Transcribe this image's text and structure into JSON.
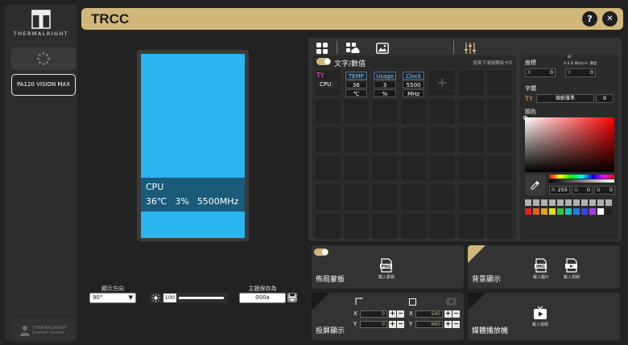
{
  "app": {
    "title": "TRCC",
    "help_label": "?",
    "close_label": "✕"
  },
  "sidebar": {
    "logo_text": "THERMALRIGHT",
    "device_label": "PA120 VISION MAX",
    "badge_line1": "THERMALRIGHT",
    "badge_line2": "Control Center"
  },
  "preview": {
    "line1": "CPU",
    "temp": "36℃",
    "usage": "3%",
    "clock": "5500MHz",
    "bg_color": "#2ab4f0",
    "band_color": "#1a5a7a"
  },
  "controls": {
    "direction_label": "顯示方向",
    "direction_value": "90°",
    "brightness_value": "100",
    "save_label": "主題保存為",
    "save_value": "000a"
  },
  "grid": {
    "title": "文字/數值",
    "hint": "按兩下清鼠刪除卡片",
    "cpu_label": "CPU",
    "columns": [
      {
        "header": "TEMP",
        "value": "36",
        "unit": "℃"
      },
      {
        "header": "Usage",
        "value": "3",
        "unit": "%"
      },
      {
        "header": "Clock",
        "value": "5500",
        "unit": "MHz"
      }
    ],
    "add_label": "+"
  },
  "props": {
    "coords_label": "座標",
    "w_label": "W",
    "hint_line": "A S D W/ctrl+ 滑鼠",
    "x_label": "X",
    "x_value": "0",
    "y_label": "Y",
    "y_value": "0",
    "font_label": "字體",
    "font_name": "微軟雅黑",
    "font_size": "9",
    "color_label": "顏色",
    "r_label": "R",
    "r_value": "255",
    "g_label": "G",
    "g_value": "0",
    "b_label": "B",
    "b_value": "0",
    "swatches_row1": [
      "#b0b0b0",
      "#b0b0b0",
      "#b0b0b0",
      "#b0b0b0",
      "#b0b0b0",
      "#b0b0b0",
      "#b0b0b0",
      "#b0b0b0",
      "#b0b0b0",
      "#b0b0b0",
      "#b0b0b0"
    ],
    "swatches_row2": [
      "#e02020",
      "#e06020",
      "#e0a020",
      "#e0e020",
      "#40c040",
      "#20c0c0",
      "#2080e0",
      "#4040e0",
      "#a040e0",
      "#ffffff",
      "#202020"
    ]
  },
  "cards": {
    "layout_title": "佈局蒙板",
    "layout_btn": "載入蒙版",
    "layout_icon_text": "PNG",
    "bg_title": "背景顯示",
    "bg_img_btn": "載入圖片",
    "bg_img_icon_text": "IMG",
    "bg_vid_btn": "載入視頻",
    "cast_title": "投屏顯示",
    "cast_x1": "0",
    "cast_y1": "0",
    "cast_x2": "540",
    "cast_y2": "960",
    "x_label": "X",
    "y_label": "Y",
    "media_title": "媒體播放機",
    "media_btn": "載入視頻"
  },
  "colors": {
    "accent": "#d2b77b",
    "panel": "#333333",
    "background": "#222222"
  }
}
